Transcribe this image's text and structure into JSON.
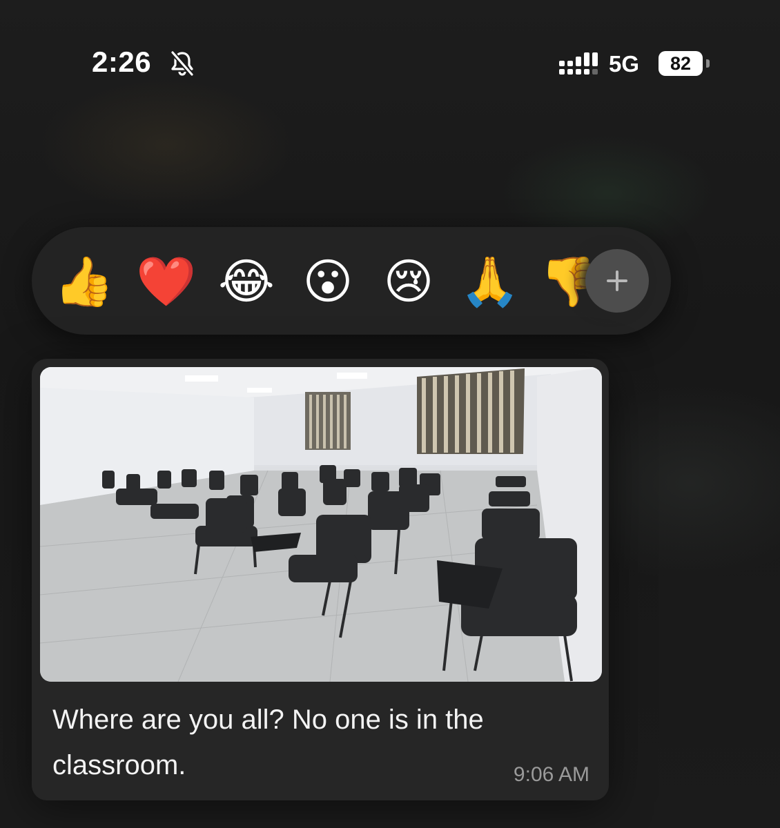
{
  "status_bar": {
    "time": "2:26",
    "network": "5G",
    "battery": "82",
    "icons": [
      "bell-slash-icon",
      "signal-icon",
      "battery-icon"
    ]
  },
  "reactions": [
    {
      "name": "thumbs-up",
      "glyph": "👍"
    },
    {
      "name": "red-heart",
      "glyph": "❤️"
    },
    {
      "name": "tears-of-joy",
      "glyph": "😂"
    },
    {
      "name": "surprised",
      "glyph": "😮"
    },
    {
      "name": "crying",
      "glyph": "😢"
    },
    {
      "name": "folded-hands",
      "glyph": "🙏"
    },
    {
      "name": "thumbs-down",
      "glyph": "👎"
    }
  ],
  "add_reaction_icon": "plus-icon",
  "message": {
    "text": "Where are you all? No one is in the classroom.",
    "time": "9:06 AM",
    "image_subject": "empty-classroom-photo"
  },
  "colors": {
    "background": "#1a1a1a",
    "bubble": "#262626",
    "reaction_bar": "#232323",
    "add_button": "#4d4d4d",
    "timestamp": "#9a9a9a"
  }
}
